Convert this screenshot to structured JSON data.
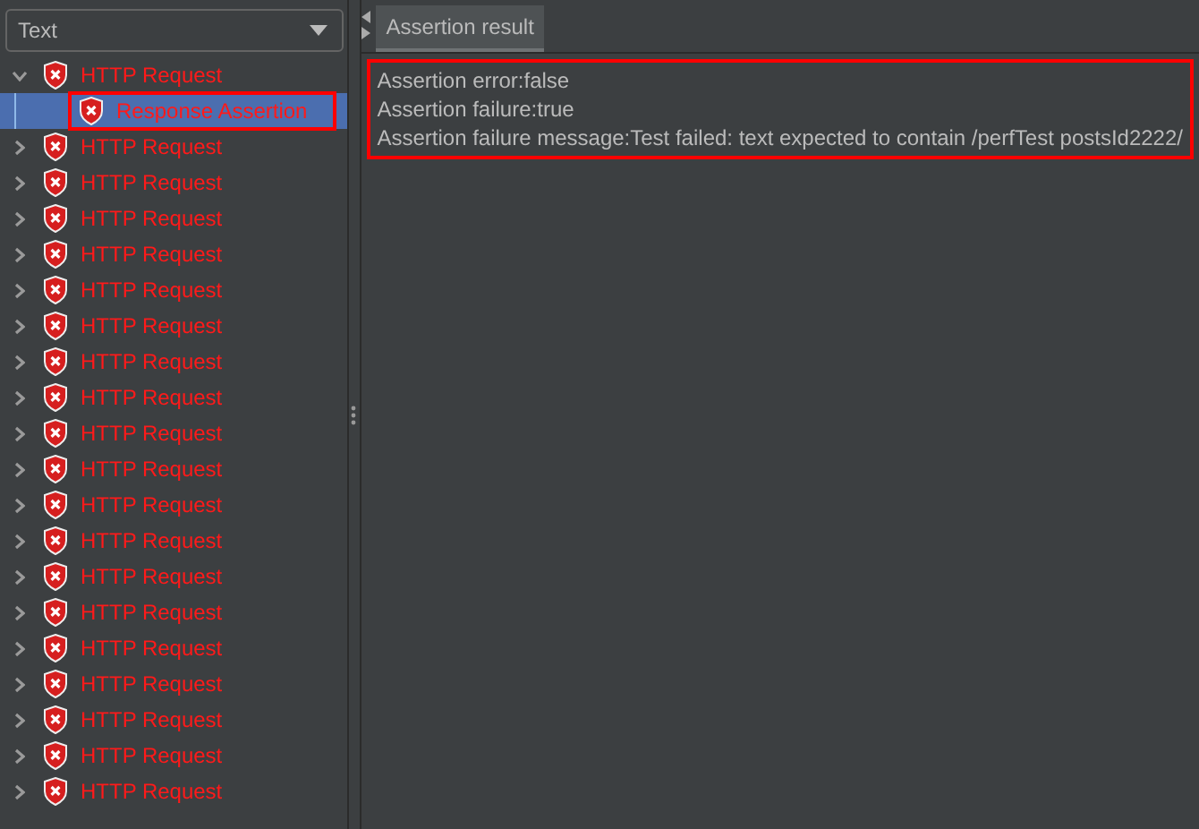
{
  "view_selector": {
    "value": "Text"
  },
  "tree": [
    {
      "label": "HTTP Request",
      "kind": "error",
      "expanded": true,
      "selected": false,
      "children": [
        {
          "label": "Response Assertion",
          "kind": "error",
          "selected": true,
          "highlighted": true
        }
      ]
    },
    {
      "label": "HTTP Request",
      "kind": "error",
      "expanded": false,
      "selected": false
    },
    {
      "label": "HTTP Request",
      "kind": "error",
      "expanded": false,
      "selected": false
    },
    {
      "label": "HTTP Request",
      "kind": "error",
      "expanded": false,
      "selected": false
    },
    {
      "label": "HTTP Request",
      "kind": "error",
      "expanded": false,
      "selected": false
    },
    {
      "label": "HTTP Request",
      "kind": "error",
      "expanded": false,
      "selected": false
    },
    {
      "label": "HTTP Request",
      "kind": "error",
      "expanded": false,
      "selected": false
    },
    {
      "label": "HTTP Request",
      "kind": "error",
      "expanded": false,
      "selected": false
    },
    {
      "label": "HTTP Request",
      "kind": "error",
      "expanded": false,
      "selected": false
    },
    {
      "label": "HTTP Request",
      "kind": "error",
      "expanded": false,
      "selected": false
    },
    {
      "label": "HTTP Request",
      "kind": "error",
      "expanded": false,
      "selected": false
    },
    {
      "label": "HTTP Request",
      "kind": "error",
      "expanded": false,
      "selected": false
    },
    {
      "label": "HTTP Request",
      "kind": "error",
      "expanded": false,
      "selected": false
    },
    {
      "label": "HTTP Request",
      "kind": "error",
      "expanded": false,
      "selected": false
    },
    {
      "label": "HTTP Request",
      "kind": "error",
      "expanded": false,
      "selected": false
    },
    {
      "label": "HTTP Request",
      "kind": "error",
      "expanded": false,
      "selected": false
    },
    {
      "label": "HTTP Request",
      "kind": "error",
      "expanded": false,
      "selected": false
    },
    {
      "label": "HTTP Request",
      "kind": "error",
      "expanded": false,
      "selected": false
    },
    {
      "label": "HTTP Request",
      "kind": "error",
      "expanded": false,
      "selected": false
    },
    {
      "label": "HTTP Request",
      "kind": "error",
      "expanded": false,
      "selected": false
    }
  ],
  "tabs": [
    {
      "label": "Assertion result",
      "selected": true
    }
  ],
  "result": {
    "highlighted": true,
    "lines": [
      "Assertion error:false",
      "Assertion failure:true",
      "Assertion failure message:Test failed: text expected to contain /perfTest postsId2222/"
    ]
  }
}
